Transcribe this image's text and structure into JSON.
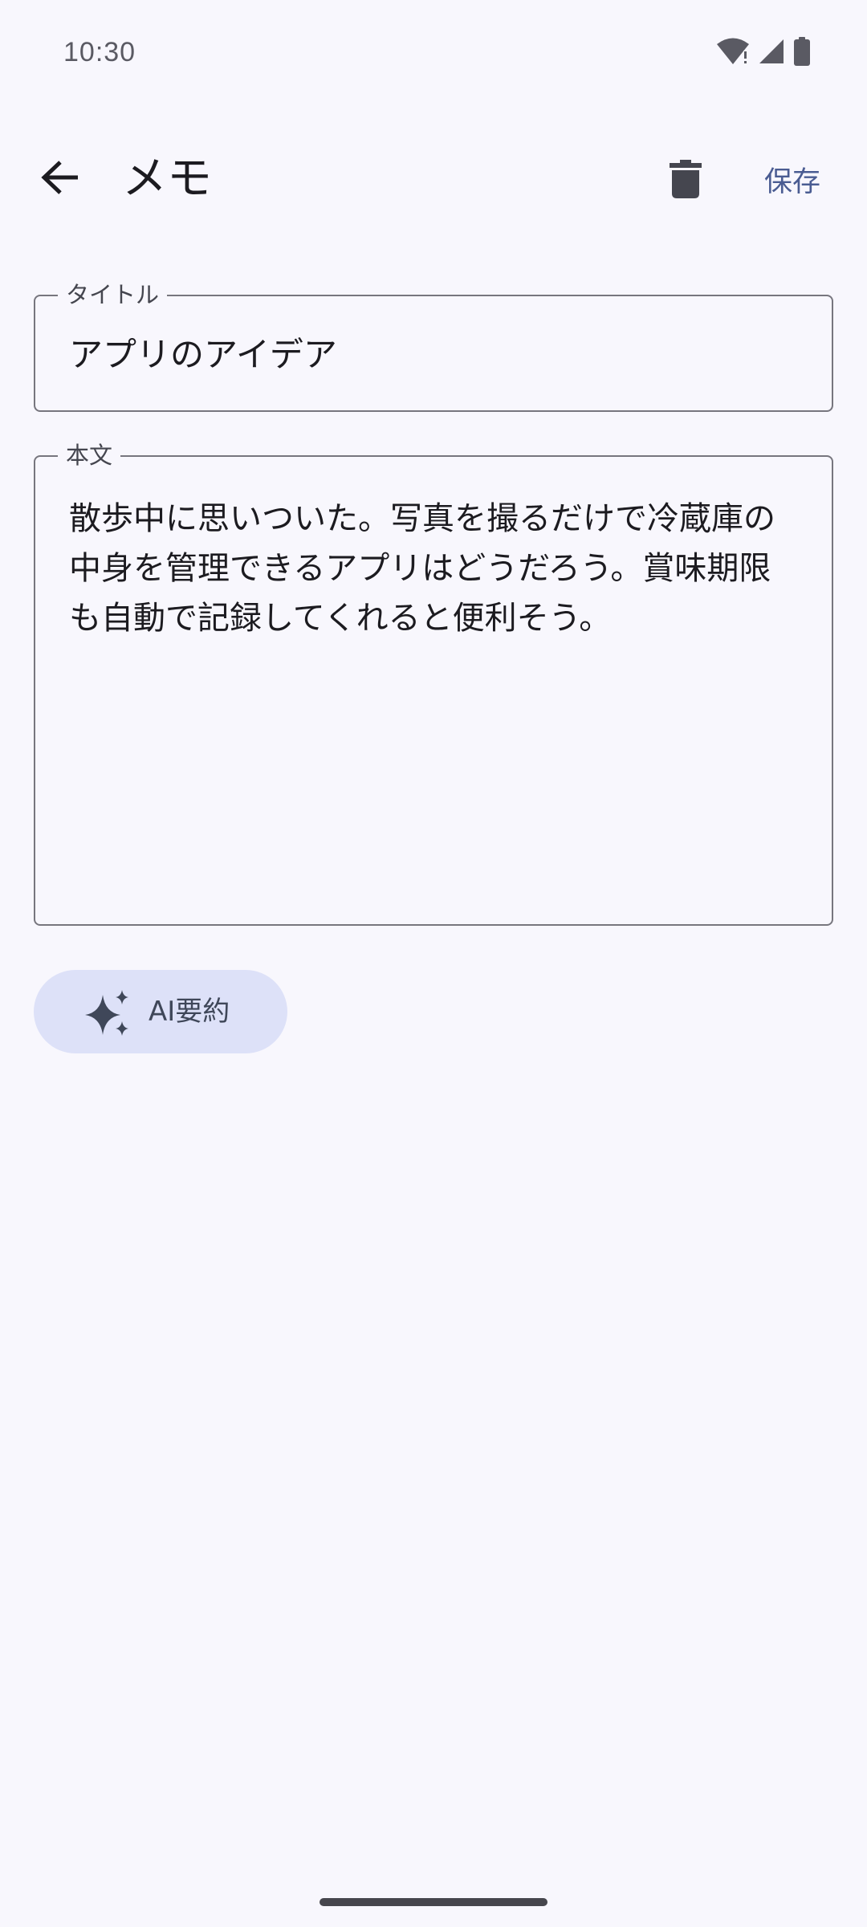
{
  "status_bar": {
    "time": "10:30",
    "icons": [
      "wifi-icon",
      "signal-icon",
      "battery-icon"
    ]
  },
  "app_bar": {
    "back_icon": "arrow-back-icon",
    "title": "メモ",
    "delete_icon": "delete-icon",
    "save_label": "保存"
  },
  "form": {
    "title_label": "タイトル",
    "title_value": "アプリのアイデア",
    "body_label": "本文",
    "body_value": "散歩中に思いついた。写真を撮るだけで冷蔵庫の中身を管理できるアプリはどうだろう。賞味期限も自動で記録してくれると便利そう。"
  },
  "ai_button": {
    "icon": "sparkle-icon",
    "label": "AI要約"
  },
  "colors": {
    "background": "#F8F7FD",
    "accent": "#4A5C92",
    "chip_background": "#DDE1F8",
    "outline": "#77767E"
  }
}
